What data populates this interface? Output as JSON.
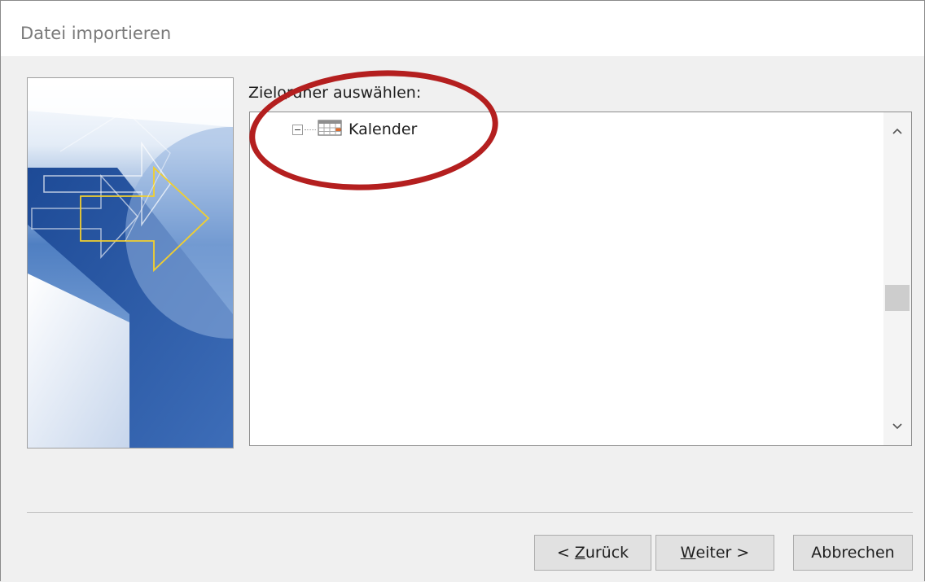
{
  "dialog": {
    "title": "Datei importieren"
  },
  "target_folder": {
    "label_before": "Ziel",
    "label_accel": "o",
    "label_after": "rdner auswählen:"
  },
  "tree": {
    "items": [
      {
        "label": "Kalender",
        "icon": "calendar-icon",
        "expanded": true
      }
    ]
  },
  "buttons": {
    "back": {
      "prefix": "< ",
      "accel": "Z",
      "rest": "urück"
    },
    "next": {
      "accel": "W",
      "rest": "eiter >"
    },
    "cancel": {
      "label": "Abbrechen"
    }
  },
  "colors": {
    "highlight_ellipse": "#b41f1f",
    "window_bg": "#f0f0f0"
  }
}
